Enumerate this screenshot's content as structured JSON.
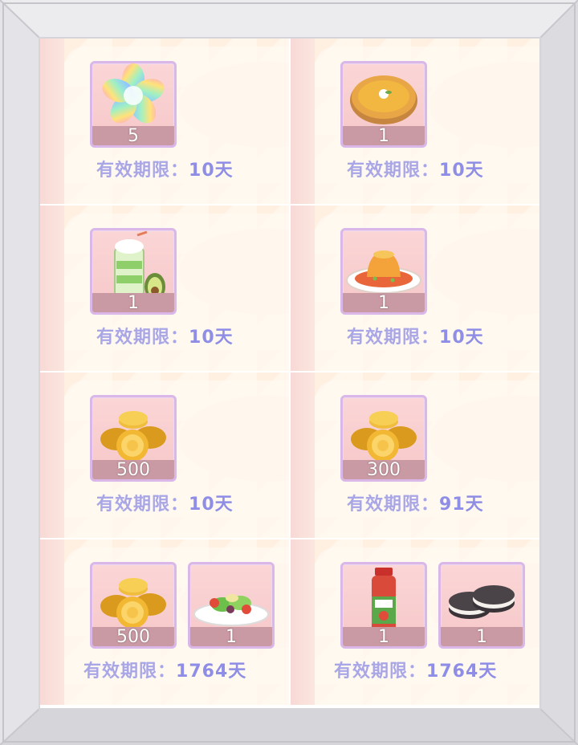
{
  "validity_label": "有效期限：",
  "colors": {
    "expiry_text": "#a9a6e6",
    "slot_bg": "#f6c7c9",
    "slot_border": "#d9b7e8",
    "qty_bar": "#c99aa3"
  },
  "rewards": [
    {
      "items": [
        {
          "icon": "rainbow-flower-icon",
          "qty": "5"
        }
      ],
      "days": "10天"
    },
    {
      "items": [
        {
          "icon": "pie-icon",
          "qty": "1"
        }
      ],
      "days": "10天"
    },
    {
      "items": [
        {
          "icon": "avocado-smoothie-icon",
          "qty": "1"
        }
      ],
      "days": "10天"
    },
    {
      "items": [
        {
          "icon": "pudding-plate-icon",
          "qty": "1"
        }
      ],
      "days": "10天"
    },
    {
      "items": [
        {
          "icon": "gold-coins-icon",
          "qty": "500"
        }
      ],
      "days": "10天"
    },
    {
      "items": [
        {
          "icon": "gold-coins-icon",
          "qty": "300"
        }
      ],
      "days": "91天"
    },
    {
      "items": [
        {
          "icon": "gold-coins-icon",
          "qty": "500"
        },
        {
          "icon": "salad-plate-icon",
          "qty": "1"
        }
      ],
      "days": "1764天"
    },
    {
      "items": [
        {
          "icon": "juice-bottle-icon",
          "qty": "1"
        },
        {
          "icon": "cookies-icon",
          "qty": "1"
        }
      ],
      "days": "1764天"
    }
  ]
}
